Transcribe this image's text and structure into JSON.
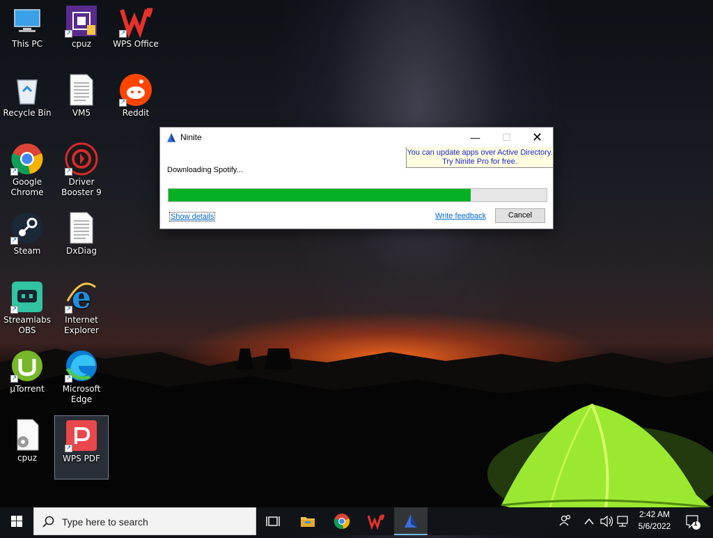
{
  "desktop": {
    "icons": [
      {
        "label": "This PC",
        "icon": "this-pc-icon",
        "shortcut": false
      },
      {
        "label": "cpuz",
        "icon": "cpuz-icon",
        "shortcut": true
      },
      {
        "label": "WPS Office",
        "icon": "wps-office-icon",
        "shortcut": true
      },
      {
        "label": "Recycle Bin",
        "icon": "recycle-bin-icon",
        "shortcut": false
      },
      {
        "label": "VM5",
        "icon": "document-icon",
        "shortcut": false
      },
      {
        "label": "Reddit",
        "icon": "reddit-icon",
        "shortcut": true
      },
      {
        "label": "Google Chrome",
        "icon": "chrome-icon",
        "shortcut": true
      },
      {
        "label": "Driver Booster 9",
        "icon": "driver-booster-icon",
        "shortcut": true
      },
      {
        "label": "Steam",
        "icon": "steam-icon",
        "shortcut": true
      },
      {
        "label": "DxDiag",
        "icon": "document-icon",
        "shortcut": false
      },
      {
        "label": "Streamlabs OBS",
        "icon": "streamlabs-icon",
        "shortcut": true
      },
      {
        "label": "Internet Explorer",
        "icon": "internet-explorer-icon",
        "shortcut": true
      },
      {
        "label": "µTorrent",
        "icon": "utorrent-icon",
        "shortcut": true
      },
      {
        "label": "Microsoft Edge",
        "icon": "edge-icon",
        "shortcut": true
      },
      {
        "label": "cpuz",
        "icon": "settings-file-icon",
        "shortcut": false
      },
      {
        "label": "WPS PDF",
        "icon": "wps-pdf-icon",
        "shortcut": true,
        "selected": true
      }
    ]
  },
  "ninite": {
    "title": "Ninite",
    "promo_line1": "You can update apps over Active Directory.",
    "promo_line2": "Try Ninite Pro for free.",
    "status": "Downloading Spotify...",
    "progress_percent": 80,
    "show_details": "Show details",
    "write_feedback": "Write feedback",
    "cancel": "Cancel",
    "progress_color": "#06b025"
  },
  "taskbar": {
    "search_placeholder": "Type here to search",
    "apps": [
      "task-view-icon",
      "file-explorer-icon",
      "chrome-icon",
      "wps-office-icon",
      "ninite-icon"
    ],
    "time": "2:42 AM",
    "date": "5/6/2022",
    "notification_count": "1"
  }
}
